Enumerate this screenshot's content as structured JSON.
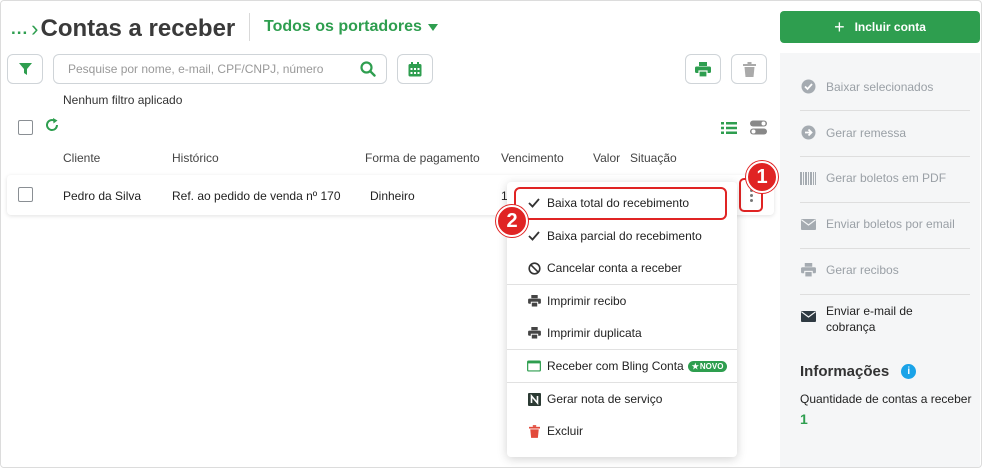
{
  "header": {
    "breadcrumb_dots": "...",
    "breadcrumb_chevron": "›",
    "title": "Contas a receber",
    "portadores": "Todos os portadores"
  },
  "toolbar": {
    "search_placeholder": "Pesquise por nome, e-mail, CPF/CNPJ, número",
    "no_filter": "Nenhum filtro aplicado"
  },
  "table": {
    "headers": {
      "cliente": "Cliente",
      "historico": "Histórico",
      "forma": "Forma de pagamento",
      "vencimento": "Vencimento",
      "valor": "Valor",
      "situacao": "Situação"
    },
    "rows": [
      {
        "cliente": "Pedro da Silva",
        "historico": "Ref. ao pedido de venda nº 170",
        "forma": "Dinheiro",
        "vencimento_partial": "1"
      }
    ]
  },
  "dropdown": {
    "items": [
      {
        "label": "Baixa total do recebimento",
        "icon": "check-icon"
      },
      {
        "label": "Baixa parcial do recebimento",
        "icon": "check-icon"
      },
      {
        "label": "Cancelar conta a receber",
        "icon": "ban-icon"
      },
      {
        "label": "Imprimir recibo",
        "icon": "printer-icon"
      },
      {
        "label": "Imprimir duplicata",
        "icon": "printer-icon"
      },
      {
        "label": "Receber com Bling Conta",
        "icon": "bling-card-icon",
        "badge": "NOVO"
      },
      {
        "label": "Gerar nota de serviço",
        "icon": "n-logo-icon"
      },
      {
        "label": "Excluir",
        "icon": "trash-icon"
      }
    ]
  },
  "annotations": {
    "badge1": "1",
    "badge2": "2"
  },
  "sidebar": {
    "incluir_plus": "+",
    "incluir_label": "Incluir conta",
    "items": [
      {
        "label": "Baixar selecionados",
        "icon": "check-circle-icon"
      },
      {
        "label": "Gerar remessa",
        "icon": "arrow-circle-icon"
      },
      {
        "label": "Gerar boletos em PDF",
        "icon": "barcode-icon"
      },
      {
        "label": "Enviar boletos por email",
        "icon": "envelope-icon"
      },
      {
        "label": "Gerar recibos",
        "icon": "printer-icon"
      },
      {
        "label": "Enviar e-mail de cobrança",
        "icon": "envelope-icon"
      }
    ],
    "info_title": "Informações",
    "info_icon": "i",
    "info_label": "Quantidade de contas a receber",
    "info_value": "1"
  },
  "colors": {
    "brand_green": "#2e9e4f",
    "annotation_red": "#e02424",
    "info_blue": "#1aa3e8"
  }
}
